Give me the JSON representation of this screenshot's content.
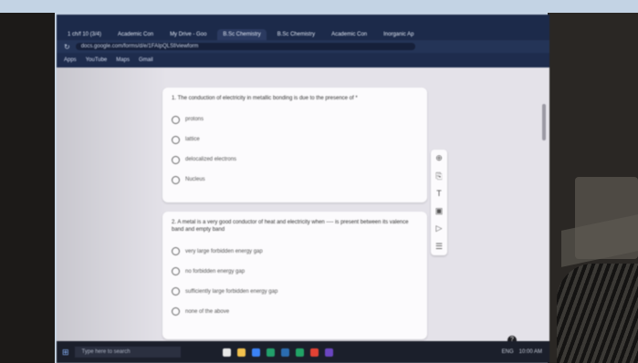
{
  "browser": {
    "tabs": [
      {
        "label": "1 ch/f 10 (3/4)"
      },
      {
        "label": "Academic Con"
      },
      {
        "label": "My Drive - Goo"
      },
      {
        "label": "B.Sc Chemistry",
        "active": true
      },
      {
        "label": "B.Sc Chemistry"
      },
      {
        "label": "Academic Con"
      },
      {
        "label": "Inorganic Ap"
      }
    ],
    "url": "docs.google.com/forms/d/e/1FAIpQLSf/viewform",
    "bookmarks": [
      "Apps",
      "YouTube",
      "Maps",
      "Gmail"
    ]
  },
  "form": {
    "q1": {
      "text": "1. The conduction of electricity in metallic bonding is due to the presence of *",
      "options": [
        "protons",
        "lattice",
        "delocalized electrons",
        "Nucleus"
      ]
    },
    "q2": {
      "text": "2. A metal is a very good conductor of heat and electricity when ---- is present between its valence band and empty band",
      "options": [
        "very large forbidden energy gap",
        "no forbidden energy gap",
        "sufficiently large forbidden energy gap",
        "none of the above"
      ]
    }
  },
  "taskbar": {
    "search_placeholder": "Type here to search",
    "tray": [
      "ENG",
      "10:00 AM"
    ]
  },
  "colors": {
    "browser_chrome": "#1c2a4a",
    "page_bg": "#e4e2e9",
    "card_bg": "#fcfbfd",
    "taskbar": "#1b1f2b"
  }
}
